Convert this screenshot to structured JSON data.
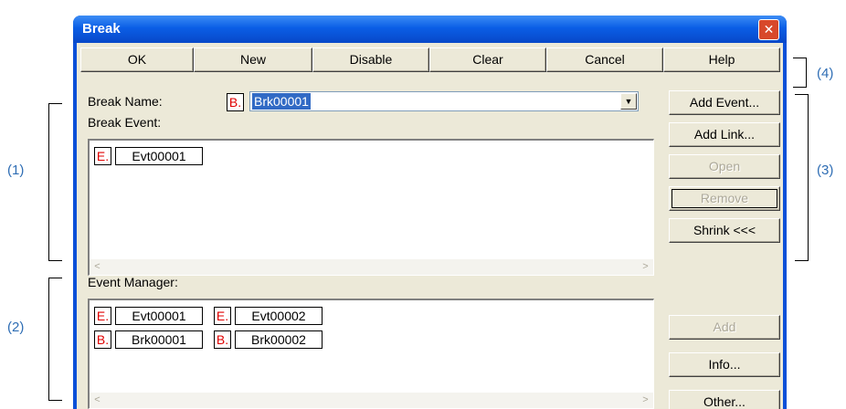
{
  "window": {
    "title": "Break",
    "close_glyph": "✕"
  },
  "toolbar": {
    "ok": "OK",
    "new": "New",
    "disable": "Disable",
    "clear": "Clear",
    "cancel": "Cancel",
    "help": "Help"
  },
  "break_name": {
    "label": "Break Name:",
    "icon_letter": "B.",
    "value": "Brk00001",
    "dropdown_arrow": "▼"
  },
  "break_event": {
    "label": "Break Event:",
    "items": [
      {
        "icon_letter": "E.",
        "name": "Evt00001"
      }
    ],
    "scroll_left": "<",
    "scroll_right": ">"
  },
  "side_buttons": {
    "add_event": "Add Event...",
    "add_link": "Add Link...",
    "open": "Open",
    "remove": "Remove",
    "shrink": "Shrink <<<",
    "add": "Add",
    "info": "Info...",
    "other": "Other..."
  },
  "event_manager": {
    "label": "Event Manager:",
    "items": [
      {
        "icon_letter": "E.",
        "name": "Evt00001"
      },
      {
        "icon_letter": "E.",
        "name": "Evt00002"
      },
      {
        "icon_letter": "B.",
        "name": "Brk00001"
      },
      {
        "icon_letter": "B.",
        "name": "Brk00002"
      }
    ],
    "scroll_left": "<",
    "scroll_right": ">"
  },
  "callouts": {
    "c1": "(1)",
    "c2": "(2)",
    "c3": "(3)",
    "c4": "(4)"
  },
  "colors": {
    "title_bar": "#0a5ee6",
    "dialog_face": "#ece9d8",
    "icon_letter": "#e00000",
    "callout_text": "#2e6db4"
  }
}
